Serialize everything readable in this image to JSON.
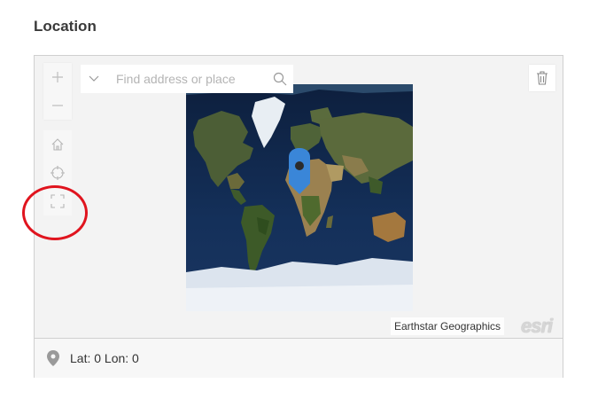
{
  "section": {
    "title": "Location"
  },
  "map": {
    "search": {
      "placeholder": "Find address or place",
      "value": ""
    },
    "attribution": "Earthstar Geographics",
    "logo_text": "esri",
    "controls": {
      "zoom_in": "plus-icon",
      "zoom_out": "minus-icon",
      "home": "home-icon",
      "locate": "locate-icon",
      "fullscreen": "fullscreen-icon",
      "delete": "trash-icon"
    },
    "marker_color": "#3a86d8"
  },
  "footer": {
    "coordinates": "Lat: 0 Lon: 0"
  },
  "annotation": {
    "color": "#e0141e"
  }
}
